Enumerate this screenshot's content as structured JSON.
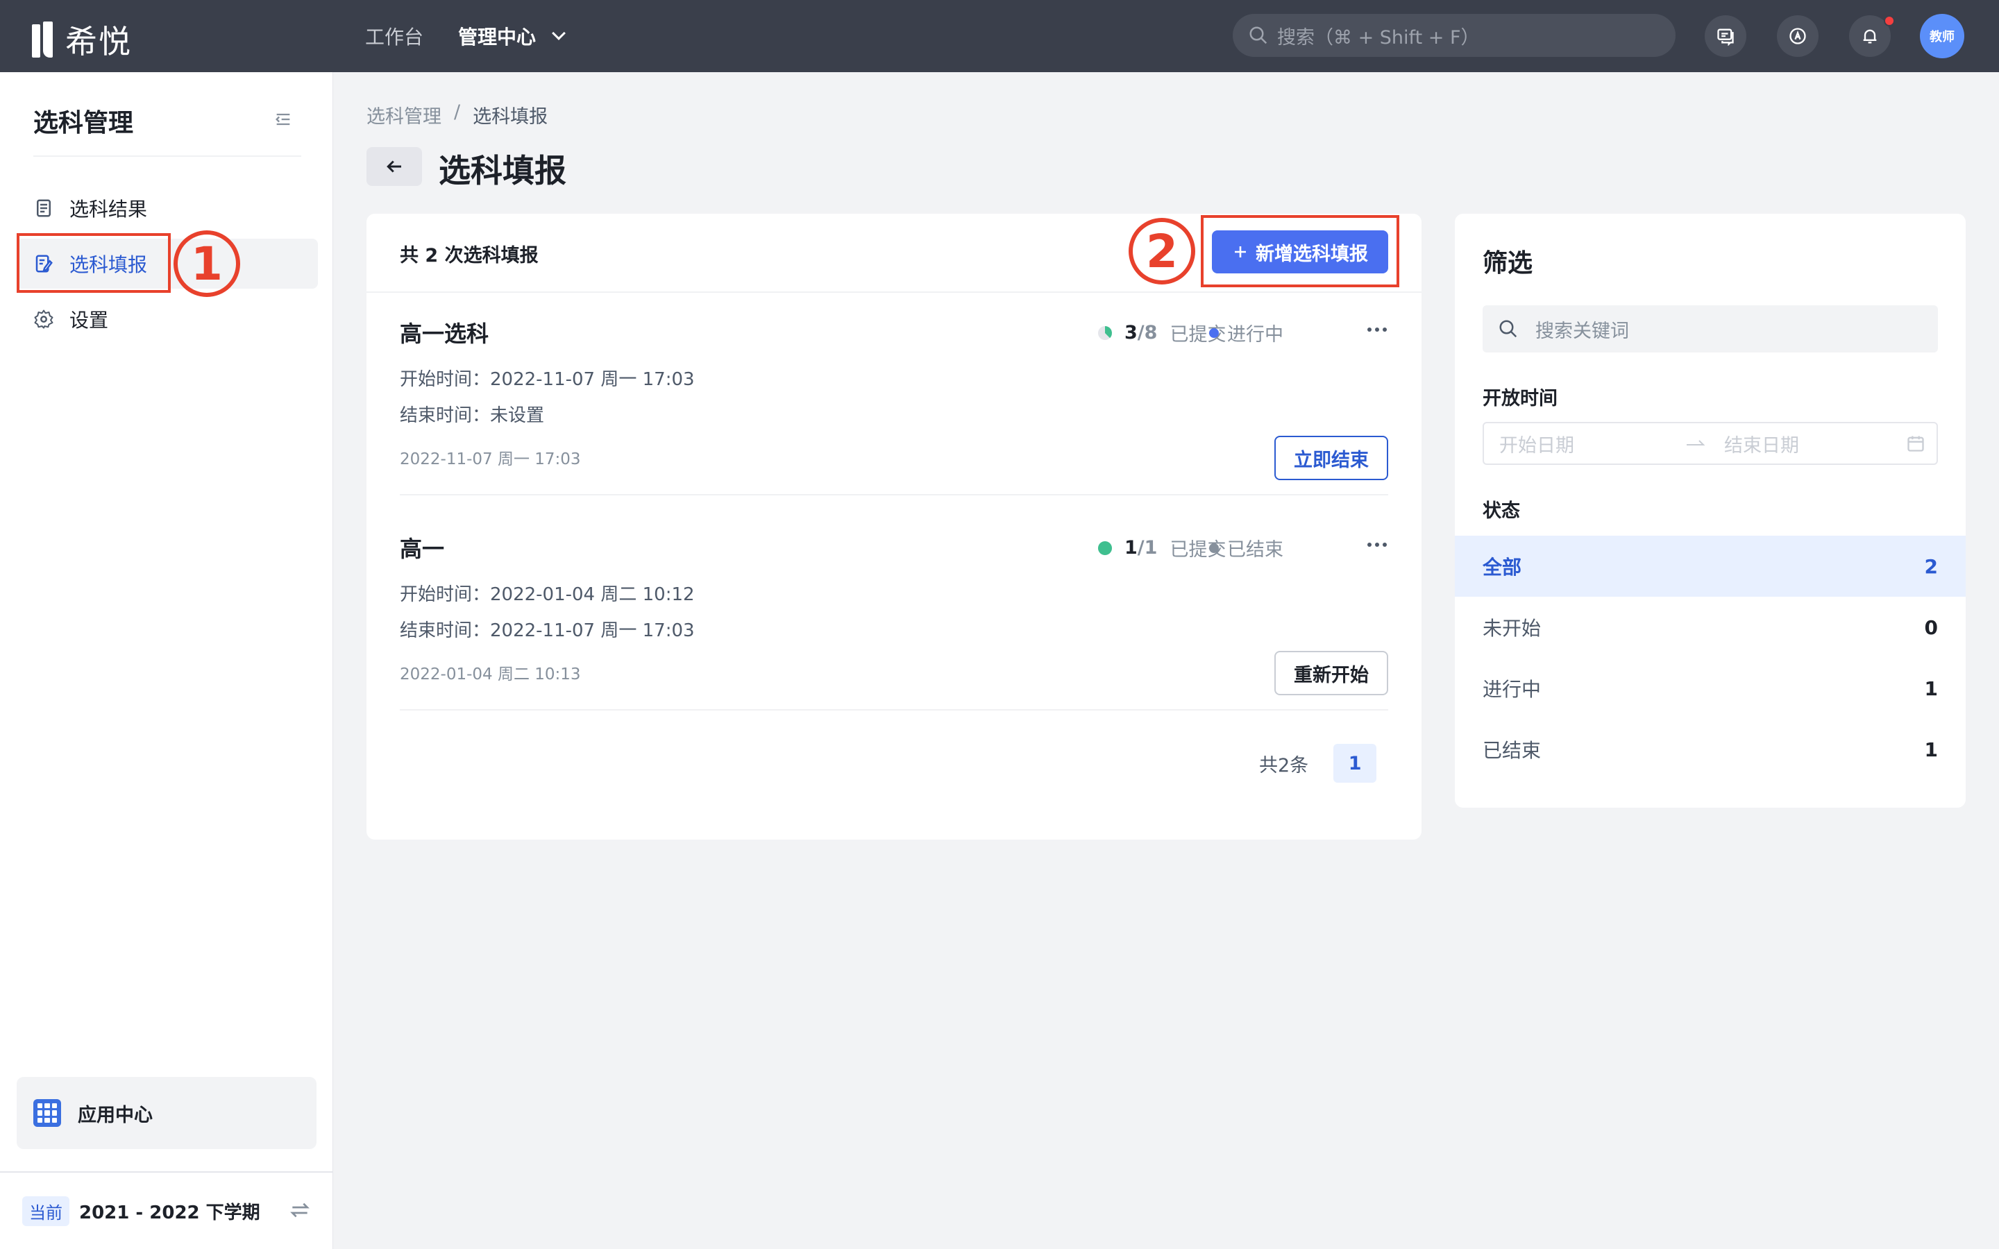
{
  "app": {
    "brand": "希悦"
  },
  "topnav": {
    "items": [
      {
        "label": "工作台"
      },
      {
        "label": "管理中心"
      }
    ],
    "search_placeholder": "搜索（⌘ + Shift + F）",
    "avatar_label": "教师"
  },
  "sidebar": {
    "title": "选科管理",
    "items": [
      {
        "label": "选科结果",
        "icon": "document-icon"
      },
      {
        "label": "选科填报",
        "icon": "edit-form-icon",
        "active": true
      },
      {
        "label": "设置",
        "icon": "gear-icon"
      }
    ],
    "app_center": "应用中心",
    "semester_tag": "当前",
    "semester": "2021 - 2022 下学期"
  },
  "annotations": {
    "mark1": "1",
    "mark2": "2"
  },
  "breadcrumb": {
    "parent": "选科管理",
    "separator": "/",
    "current": "选科填报"
  },
  "page": {
    "title": "选科填报"
  },
  "main": {
    "count_text": "共 2 次选科填报",
    "add_button": "新增选科填报",
    "records": [
      {
        "title": "高一选科",
        "submitted": "3",
        "total": "/8",
        "submitted_label": "已提交",
        "submitted_fraction": 0.375,
        "status": "进行中",
        "status_color": "#4a6ff0",
        "start": "开始时间：2022-11-07 周一 17:03",
        "end": "结束时间：未设置",
        "created": "2022-11-07 周一 17:03",
        "action": "立即结束"
      },
      {
        "title": "高一",
        "submitted": "1",
        "total": "/1",
        "submitted_label": "已提交",
        "submitted_fraction": 1,
        "status": "已结束",
        "status_color": "#86909c",
        "start": "开始时间：2022-01-04 周二 10:12",
        "end": "结束时间：2022-11-07 周一 17:03",
        "created": "2022-01-04 周二 10:13",
        "action": "重新开始"
      }
    ],
    "pager": {
      "total": "共2条",
      "page": "1"
    }
  },
  "filter": {
    "title": "筛选",
    "keyword_placeholder": "搜索关键词",
    "open_time_label": "开放时间",
    "start_placeholder": "开始日期",
    "end_placeholder": "结束日期",
    "status_label": "状态",
    "statuses": [
      {
        "label": "全部",
        "count": "2"
      },
      {
        "label": "未开始",
        "count": "0"
      },
      {
        "label": "进行中",
        "count": "1"
      },
      {
        "label": "已结束",
        "count": "1"
      }
    ]
  },
  "colors": {
    "accent": "#4a6ff0",
    "annotation": "#e8412c",
    "topbar": "#3a3f4b"
  }
}
